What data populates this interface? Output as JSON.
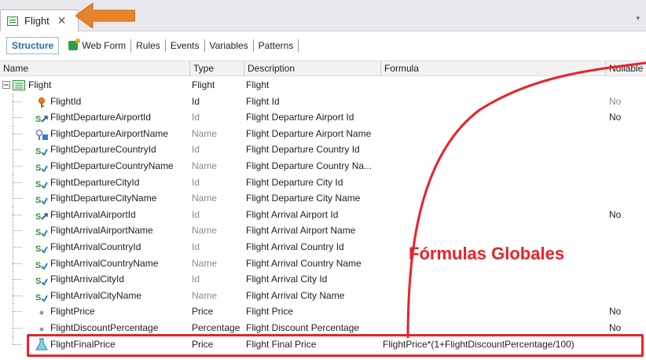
{
  "tab": {
    "title": "Flight",
    "close": "✕",
    "dropdown": "▾"
  },
  "subtabs": [
    {
      "label": "Structure",
      "active": true
    },
    {
      "label": "Web Form"
    },
    {
      "label": "Rules"
    },
    {
      "label": "Events"
    },
    {
      "label": "Variables"
    },
    {
      "label": "Patterns"
    }
  ],
  "columns": {
    "name": "Name",
    "type": "Type",
    "description": "Description",
    "formula": "Formula",
    "nullable": "Nullable"
  },
  "root": {
    "name": "Flight",
    "type": "Flight",
    "description": "Flight"
  },
  "rows": [
    {
      "name": "FlightId",
      "type": "Id",
      "description": "Flight Id",
      "formula": "",
      "nullable": "No",
      "icon": "key-icon",
      "type_muted": false,
      "null_muted": true
    },
    {
      "name": "FlightDepartureAirportId",
      "type": "Id",
      "description": "Flight Departure Airport Id",
      "formula": "",
      "nullable": "No",
      "icon": "foreign-key-icon",
      "type_muted": true,
      "null_muted": false
    },
    {
      "name": "FlightDepartureAirportName",
      "type": "Name",
      "description": "Flight Departure Airport Name",
      "formula": "",
      "nullable": "",
      "icon": "inferred-key-icon",
      "type_muted": true
    },
    {
      "name": "FlightDepartureCountryId",
      "type": "Id",
      "description": "Flight Departure Country Id",
      "formula": "",
      "nullable": "",
      "icon": "subtype-icon",
      "type_muted": true
    },
    {
      "name": "FlightDepartureCountryName",
      "type": "Name",
      "description": "Flight Departure Country Na...",
      "formula": "",
      "nullable": "",
      "icon": "subtype-icon",
      "type_muted": true
    },
    {
      "name": "FlightDepartureCityId",
      "type": "Id",
      "description": "Flight Departure City Id",
      "formula": "",
      "nullable": "",
      "icon": "subtype-icon",
      "type_muted": true
    },
    {
      "name": "FlightDepartureCityName",
      "type": "Name",
      "description": "Flight Departure City Name",
      "formula": "",
      "nullable": "",
      "icon": "subtype-icon",
      "type_muted": true
    },
    {
      "name": "FlightArrivalAirportId",
      "type": "Id",
      "description": "Flight Arrival Airport Id",
      "formula": "",
      "nullable": "No",
      "icon": "foreign-key-icon",
      "type_muted": true,
      "null_muted": false
    },
    {
      "name": "FlightArrivalAirportName",
      "type": "Name",
      "description": "Flight Arrival Airport Name",
      "formula": "",
      "nullable": "",
      "icon": "subtype-icon",
      "type_muted": true
    },
    {
      "name": "FlightArrivalCountryId",
      "type": "Id",
      "description": "Flight Arrival Country Id",
      "formula": "",
      "nullable": "",
      "icon": "subtype-icon",
      "type_muted": true
    },
    {
      "name": "FlightArrivalCountryName",
      "type": "Name",
      "description": "Flight Arrival Country Name",
      "formula": "",
      "nullable": "",
      "icon": "subtype-icon",
      "type_muted": true
    },
    {
      "name": "FlightArrivalCityId",
      "type": "Id",
      "description": "Flight Arrival City Id",
      "formula": "",
      "nullable": "",
      "icon": "subtype-icon",
      "type_muted": true
    },
    {
      "name": "FlightArrivalCityName",
      "type": "Name",
      "description": "Flight Arrival City Name",
      "formula": "",
      "nullable": "",
      "icon": "subtype-icon",
      "type_muted": true
    },
    {
      "name": "FlightPrice",
      "type": "Price",
      "description": "Flight Price",
      "formula": "",
      "nullable": "No",
      "icon": "attribute-dot-icon",
      "type_muted": false,
      "null_muted": false
    },
    {
      "name": "FlightDiscountPercentage",
      "type": "Percentage",
      "description": "Flight Discount Percentage",
      "formula": "",
      "nullable": "No",
      "icon": "attribute-dot-icon",
      "type_muted": false,
      "null_muted": false
    },
    {
      "name": "FlightFinalPrice",
      "type": "Price",
      "description": "Flight Final Price",
      "formula": "FlightPrice*(1+FlightDiscountPercentage/100)",
      "nullable": "",
      "icon": "formula-flask-icon",
      "type_muted": false
    }
  ],
  "callout": "Fórmulas Globales",
  "colors": {
    "accent_red": "#e8232a",
    "arrow_orange": "#e8822b",
    "link_blue": "#2b6cb0"
  }
}
